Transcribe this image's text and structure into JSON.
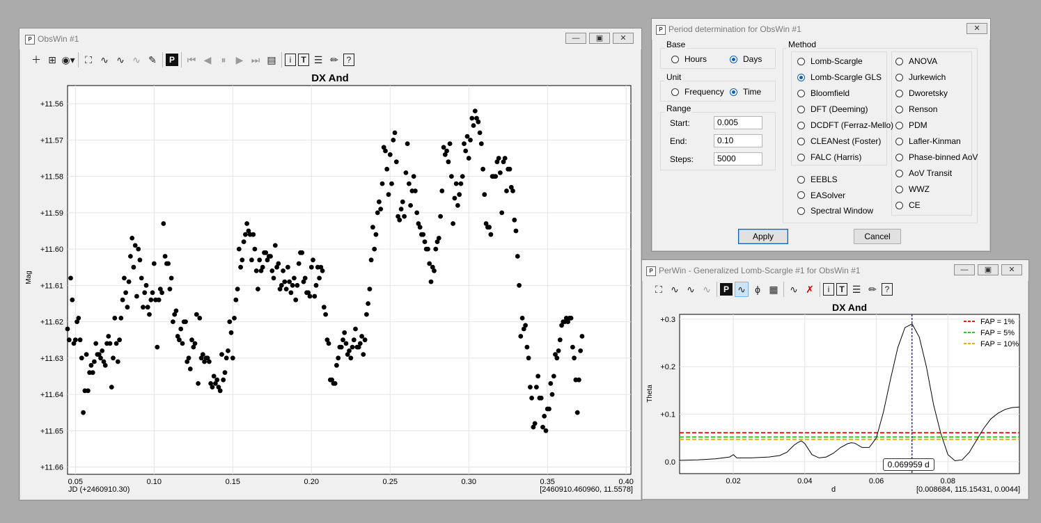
{
  "obswin": {
    "title": "ObsWin #1",
    "chart_title": "DX And",
    "ylabel": "Mag",
    "xlabel_left": "JD (+2460910.30)",
    "xlabel_right": "[2460910.460960, 11.5578]",
    "toolbar_p": "P"
  },
  "perdet": {
    "title": "Period determination for ObsWin #1",
    "base_label": "Base",
    "base_hours": "Hours",
    "base_days": "Days",
    "unit_label": "Unit",
    "unit_frequency": "Frequency",
    "unit_time": "Time",
    "range_label": "Range",
    "start_label": "Start:",
    "start_value": "0.005",
    "end_label": "End:",
    "end_value": "0.10",
    "steps_label": "Steps:",
    "steps_value": "5000",
    "method_label": "Method",
    "methods_left": [
      "Lomb-Scargle",
      "Lomb-Scargle GLS",
      "Bloomfield",
      "DFT (Deeming)",
      "DCDFT (Ferraz-Mello)",
      "CLEANest (Foster)",
      "FALC (Harris)"
    ],
    "methods_extra": [
      "EEBLS",
      "EASolver",
      "Spectral Window"
    ],
    "methods_right": [
      "ANOVA",
      "Jurkewich",
      "Dworetsky",
      "Renson",
      "PDM",
      "Lafler-Kinman",
      "Phase-binned AoV",
      "AoV Transit",
      "WWZ",
      "CE"
    ],
    "selected_method": "Lomb-Scargle GLS",
    "apply_label": "Apply",
    "cancel_label": "Cancel"
  },
  "perwin": {
    "title": "PerWin - Generalized Lomb-Scargle #1 for ObsWin #1",
    "chart_title": "DX And",
    "ylabel": "Theta",
    "xlabel": "d",
    "xlabel_right": "[0.008684, 115.15431, 0.0044]",
    "peak_label": "0.069959 d",
    "toolbar_p": "P"
  },
  "colors": {
    "fap1": "#e01a1a",
    "fap5": "#2ec52e",
    "fap10": "#f0a70c",
    "cursor": "#2b2bb5",
    "selected_radio": "#0a5fb4"
  },
  "chart_data": [
    {
      "type": "scatter",
      "title": "DX And",
      "xlabel": "JD (+2460910.30)",
      "ylabel": "Mag",
      "xlim": [
        0.045,
        0.403
      ],
      "ylim": [
        11.555,
        11.662
      ],
      "y_inverted": true,
      "xticks": [
        "0.05",
        "0.10",
        "0.15",
        "0.20",
        "0.25",
        "0.30",
        "0.35",
        "0.40"
      ],
      "yticks": [
        "+11.56",
        "+11.57",
        "+11.58",
        "+11.59",
        "+11.60",
        "+11.61",
        "+11.62",
        "+11.63",
        "+11.64",
        "+11.65",
        "+11.66"
      ],
      "grid": true,
      "x": [
        0.039,
        0.04,
        0.041,
        0.042,
        0.043,
        0.044,
        0.045,
        0.046,
        0.047,
        0.048,
        0.049,
        0.05,
        0.051,
        0.052,
        0.053,
        0.054,
        0.055,
        0.056,
        0.057,
        0.058,
        0.059,
        0.06,
        0.061,
        0.062,
        0.063,
        0.064,
        0.065,
        0.066,
        0.067,
        0.068,
        0.069,
        0.07,
        0.071,
        0.072,
        0.073,
        0.074,
        0.075,
        0.076,
        0.077,
        0.078,
        0.079,
        0.08,
        0.081,
        0.082,
        0.083,
        0.084,
        0.085,
        0.086,
        0.087,
        0.088,
        0.089,
        0.09,
        0.091,
        0.092,
        0.093,
        0.094,
        0.095,
        0.096,
        0.097,
        0.098,
        0.099,
        0.1,
        0.101,
        0.102,
        0.103,
        0.104,
        0.105,
        0.106,
        0.107,
        0.108,
        0.109,
        0.11,
        0.111,
        0.112,
        0.113,
        0.114,
        0.115,
        0.116,
        0.117,
        0.118,
        0.119,
        0.12,
        0.121,
        0.122,
        0.123,
        0.124,
        0.125,
        0.126,
        0.127,
        0.128,
        0.129,
        0.13,
        0.131,
        0.132,
        0.133,
        0.134,
        0.135,
        0.136,
        0.137,
        0.138,
        0.139,
        0.14,
        0.141,
        0.142,
        0.143,
        0.144,
        0.145,
        0.146,
        0.147,
        0.148,
        0.149,
        0.15,
        0.151,
        0.152,
        0.153,
        0.154,
        0.155,
        0.156,
        0.157,
        0.158,
        0.159,
        0.16,
        0.161,
        0.162,
        0.163,
        0.164,
        0.165,
        0.166,
        0.167,
        0.168,
        0.169,
        0.17,
        0.171,
        0.172,
        0.173,
        0.174,
        0.175,
        0.176,
        0.177,
        0.178,
        0.179,
        0.18,
        0.181,
        0.182,
        0.183,
        0.184,
        0.185,
        0.186,
        0.187,
        0.188,
        0.189,
        0.19,
        0.191,
        0.192,
        0.193,
        0.194,
        0.195,
        0.196,
        0.197,
        0.198,
        0.199,
        0.2,
        0.201,
        0.202,
        0.203,
        0.204,
        0.205,
        0.206,
        0.207,
        0.208,
        0.209,
        0.21,
        0.211,
        0.212,
        0.213,
        0.214,
        0.215,
        0.216,
        0.217,
        0.218,
        0.219,
        0.22,
        0.221,
        0.222,
        0.223,
        0.224,
        0.225,
        0.226,
        0.227,
        0.228,
        0.229,
        0.23,
        0.231,
        0.232,
        0.233,
        0.234,
        0.235,
        0.236,
        0.237,
        0.238,
        0.239,
        0.24,
        0.241,
        0.242,
        0.243,
        0.244,
        0.245,
        0.246,
        0.247,
        0.248,
        0.249,
        0.25,
        0.251,
        0.252,
        0.253,
        0.254,
        0.255,
        0.256,
        0.257,
        0.258,
        0.259,
        0.26,
        0.261,
        0.262,
        0.263,
        0.264,
        0.265,
        0.266,
        0.267,
        0.268,
        0.269,
        0.27,
        0.271,
        0.272,
        0.273,
        0.274,
        0.275,
        0.276,
        0.277,
        0.278,
        0.279,
        0.28,
        0.281,
        0.282,
        0.283,
        0.284,
        0.285,
        0.286,
        0.287,
        0.288,
        0.289,
        0.29,
        0.291,
        0.292,
        0.293,
        0.294,
        0.295,
        0.296,
        0.297,
        0.298,
        0.299,
        0.3,
        0.301,
        0.302,
        0.303,
        0.304,
        0.305,
        0.306,
        0.307,
        0.308,
        0.309,
        0.31,
        0.311,
        0.312,
        0.313,
        0.314,
        0.315,
        0.316,
        0.317,
        0.318,
        0.319,
        0.32,
        0.321,
        0.322,
        0.323,
        0.324,
        0.325,
        0.326,
        0.327,
        0.328,
        0.329,
        0.33,
        0.331,
        0.332,
        0.333,
        0.334,
        0.335,
        0.336,
        0.337,
        0.338,
        0.339,
        0.34,
        0.341,
        0.342,
        0.343,
        0.344,
        0.345,
        0.346,
        0.347,
        0.348,
        0.349,
        0.35,
        0.351,
        0.352,
        0.353,
        0.354,
        0.355,
        0.356,
        0.357,
        0.358,
        0.359,
        0.36,
        0.361,
        0.362,
        0.363,
        0.364,
        0.365,
        0.366,
        0.367,
        0.368,
        0.369,
        0.37,
        0.371,
        0.372
      ],
      "y": [
        11.612,
        11.612,
        11.606,
        11.605,
        11.602,
        11.627,
        11.622,
        11.625,
        11.608,
        11.614,
        11.626,
        11.625,
        11.62,
        11.619,
        11.625,
        11.63,
        11.645,
        11.639,
        11.629,
        11.639,
        11.634,
        11.632,
        11.634,
        11.631,
        11.626,
        11.629,
        11.629,
        11.63,
        11.628,
        11.631,
        11.632,
        11.626,
        11.624,
        11.626,
        11.638,
        11.63,
        11.619,
        11.626,
        11.631,
        11.625,
        11.619,
        11.614,
        11.608,
        11.612,
        11.616,
        11.609,
        11.602,
        11.597,
        11.605,
        11.599,
        11.613,
        11.6,
        11.603,
        11.608,
        11.616,
        11.612,
        11.61,
        11.616,
        11.618,
        11.614,
        11.612,
        11.604,
        11.614,
        11.627,
        11.614,
        11.611,
        11.612,
        11.593,
        11.602,
        11.604,
        11.604,
        11.611,
        11.608,
        11.62,
        11.618,
        11.617,
        11.624,
        11.625,
        11.622,
        11.626,
        11.62,
        11.62,
        11.631,
        11.63,
        11.633,
        11.625,
        11.627,
        11.626,
        11.618,
        11.637,
        11.619,
        11.63,
        11.629,
        11.631,
        11.63,
        11.63,
        11.631,
        11.637,
        11.638,
        11.635,
        11.637,
        11.636,
        11.638,
        11.639,
        11.629,
        11.636,
        11.634,
        11.63,
        11.628,
        11.62,
        11.623,
        11.63,
        11.619,
        11.614,
        11.611,
        11.6,
        11.605,
        11.603,
        11.598,
        11.596,
        11.593,
        11.595,
        11.596,
        11.603,
        11.596,
        11.6,
        11.606,
        11.611,
        11.603,
        11.606,
        11.605,
        11.601,
        11.601,
        11.603,
        11.602,
        11.602,
        11.606,
        11.608,
        11.599,
        11.605,
        11.604,
        11.611,
        11.61,
        11.606,
        11.609,
        11.611,
        11.605,
        11.609,
        11.612,
        11.61,
        11.608,
        11.614,
        11.61,
        11.604,
        11.601,
        11.601,
        11.609,
        11.608,
        11.612,
        11.612,
        11.613,
        11.605,
        11.603,
        11.613,
        11.61,
        11.605,
        11.608,
        11.605,
        11.606,
        11.616,
        11.618,
        11.625,
        11.626,
        11.636,
        11.636,
        11.637,
        11.637,
        11.632,
        11.63,
        11.627,
        11.627,
        11.625,
        11.623,
        11.626,
        11.629,
        11.628,
        11.63,
        11.627,
        11.625,
        11.622,
        11.627,
        11.627,
        11.626,
        11.624,
        11.629,
        11.625,
        11.618,
        11.615,
        11.611,
        11.603,
        11.594,
        11.6,
        11.596,
        11.59,
        11.587,
        11.589,
        11.582,
        11.572,
        11.573,
        11.578,
        11.585,
        11.574,
        11.582,
        11.57,
        11.568,
        11.576,
        11.591,
        11.592,
        11.589,
        11.587,
        11.591,
        11.579,
        11.571,
        11.582,
        11.588,
        11.584,
        11.58,
        11.584,
        11.59,
        11.593,
        11.594,
        11.596,
        11.596,
        11.598,
        11.6,
        11.6,
        11.604,
        11.609,
        11.605,
        11.606,
        11.6,
        11.598,
        11.597,
        11.591,
        11.584,
        11.572,
        11.574,
        11.573,
        11.576,
        11.571,
        11.58,
        11.593,
        11.586,
        11.582,
        11.588,
        11.585,
        11.582,
        11.58,
        11.571,
        11.573,
        11.569,
        11.575,
        11.57,
        11.564,
        11.566,
        11.562,
        11.564,
        11.565,
        11.568,
        11.571,
        11.578,
        11.585,
        11.593,
        11.594,
        11.594,
        11.596,
        11.58,
        11.58,
        11.58,
        11.576,
        11.575,
        11.579,
        11.59,
        11.576,
        11.575,
        11.584,
        11.578,
        11.578,
        11.583,
        11.584,
        11.592,
        11.595,
        11.602,
        11.61,
        11.624,
        11.619,
        11.622,
        11.621,
        11.627,
        11.63,
        11.638,
        11.641,
        11.649,
        11.648,
        11.638,
        11.635,
        11.641,
        11.641,
        11.649,
        11.646,
        11.65,
        11.644,
        11.644,
        11.637,
        11.64,
        11.635,
        11.629,
        11.63,
        11.628,
        11.625,
        11.621,
        11.62,
        11.62,
        11.619,
        11.62,
        11.619,
        11.619,
        11.627,
        11.63,
        11.636,
        11.645,
        11.636,
        11.628,
        11.624,
        11.623,
        11.622,
        11.62,
        11.619
      ],
      "note_y_matches_visible_scatter": true
    },
    {
      "type": "line",
      "title": "DX And",
      "xlabel": "d",
      "ylabel": "Theta",
      "xlim": [
        0.005,
        0.1
      ],
      "ylim": [
        -0.025,
        0.31
      ],
      "xticks": [
        "0.02",
        "0.04",
        "0.06",
        "0.08"
      ],
      "yticks": [
        "0.0",
        "+0.1",
        "+0.2",
        "+0.3"
      ],
      "grid": true,
      "series": [
        {
          "x": [
            0.005,
            0.01,
            0.015,
            0.019,
            0.02,
            0.021,
            0.025,
            0.03,
            0.033,
            0.035,
            0.037,
            0.038,
            0.039,
            0.04,
            0.042,
            0.044,
            0.046,
            0.048,
            0.05,
            0.052,
            0.053,
            0.054,
            0.056,
            0.058,
            0.06,
            0.062,
            0.064,
            0.066,
            0.068,
            0.07,
            0.072,
            0.074,
            0.076,
            0.078,
            0.08,
            0.082,
            0.084,
            0.086,
            0.088,
            0.09,
            0.092,
            0.094,
            0.096,
            0.098,
            0.1
          ],
          "y": [
            0.003,
            0.004,
            0.006,
            0.01,
            0.015,
            0.008,
            0.008,
            0.01,
            0.013,
            0.02,
            0.035,
            0.04,
            0.044,
            0.038,
            0.015,
            0.008,
            0.01,
            0.018,
            0.03,
            0.038,
            0.04,
            0.039,
            0.03,
            0.03,
            0.05,
            0.105,
            0.175,
            0.24,
            0.282,
            0.29,
            0.262,
            0.2,
            0.12,
            0.06,
            0.015,
            0.002,
            0.004,
            0.02,
            0.045,
            0.07,
            0.09,
            0.102,
            0.11,
            0.114,
            0.115
          ]
        }
      ],
      "legend": [
        "FAP = 1%",
        "FAP = 5%",
        "FAP = 10%"
      ],
      "legend_placement": "top-right",
      "fap_levels": [
        0.061,
        0.052,
        0.047
      ],
      "cursor_x": 0.069959
    }
  ]
}
